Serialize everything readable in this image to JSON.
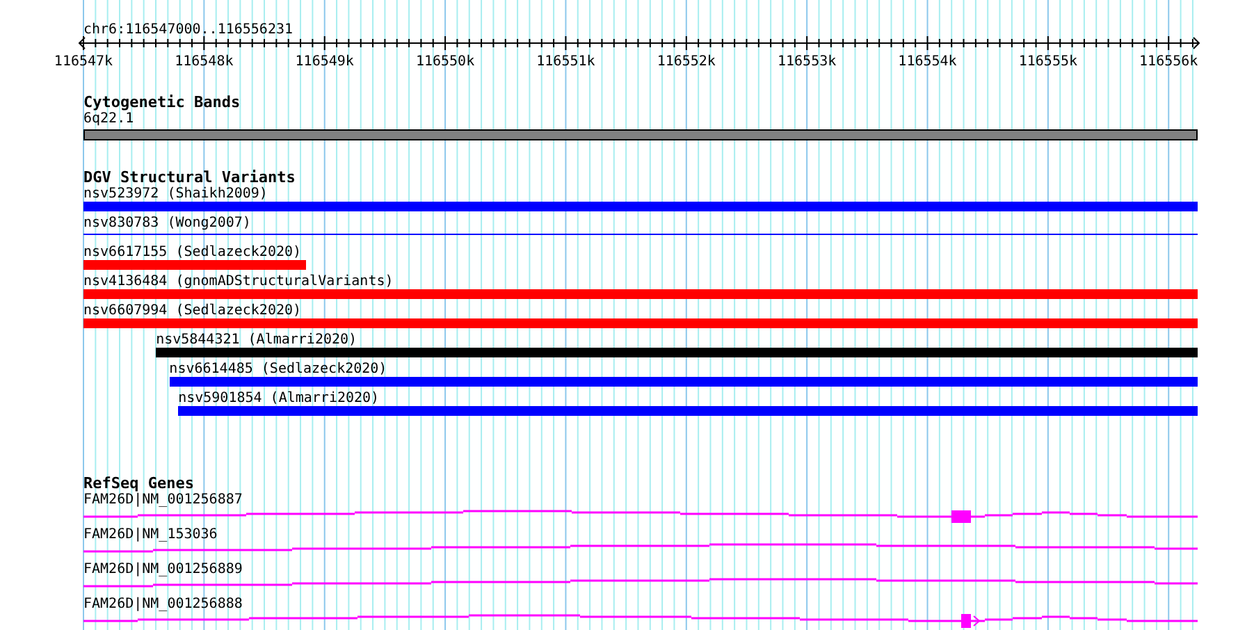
{
  "ruler": {
    "location": "chr6:116547000..116556231",
    "tick_labels": [
      "116547k",
      "116548k",
      "116549k",
      "116550k",
      "116551k",
      "116552k",
      "116553k",
      "116554k",
      "116555k",
      "116556k"
    ]
  },
  "cytogenetic_bands": {
    "title": "Cytogenetic Bands",
    "bands": [
      {
        "label": "6q22.1"
      }
    ]
  },
  "dgv_structural_variants": {
    "title": "DGV Structural Variants",
    "features": [
      {
        "label": "nsv523972 (Shaikh2009)",
        "kind": "bar",
        "color": "#0000ff"
      },
      {
        "label": "nsv830783 (Wong2007)",
        "kind": "line",
        "color": "#0000ff"
      },
      {
        "label": "nsv6617155 (Sedlazeck2020)",
        "kind": "bar",
        "color": "#ff0000"
      },
      {
        "label": "nsv4136484 (gnomADStructuralVariants)",
        "kind": "bar",
        "color": "#ff0000"
      },
      {
        "label": "nsv6607994 (Sedlazeck2020)",
        "kind": "bar",
        "color": "#ff0000"
      },
      {
        "label": "nsv5844321 (Almarri2020)",
        "kind": "bar",
        "color": "#000000"
      },
      {
        "label": "nsv6614485 (Sedlazeck2020)",
        "kind": "bar",
        "color": "#0000ff"
      },
      {
        "label": "nsv5901854 (Almarri2020)",
        "kind": "bar",
        "color": "#0000ff"
      }
    ]
  },
  "refseq_genes": {
    "title": "RefSeq Genes",
    "transcripts": [
      {
        "label": "FAM26D|NM_001256887"
      },
      {
        "label": "FAM26D|NM_153036"
      },
      {
        "label": "FAM26D|NM_001256889"
      },
      {
        "label": "FAM26D|NM_001256888"
      }
    ]
  }
}
